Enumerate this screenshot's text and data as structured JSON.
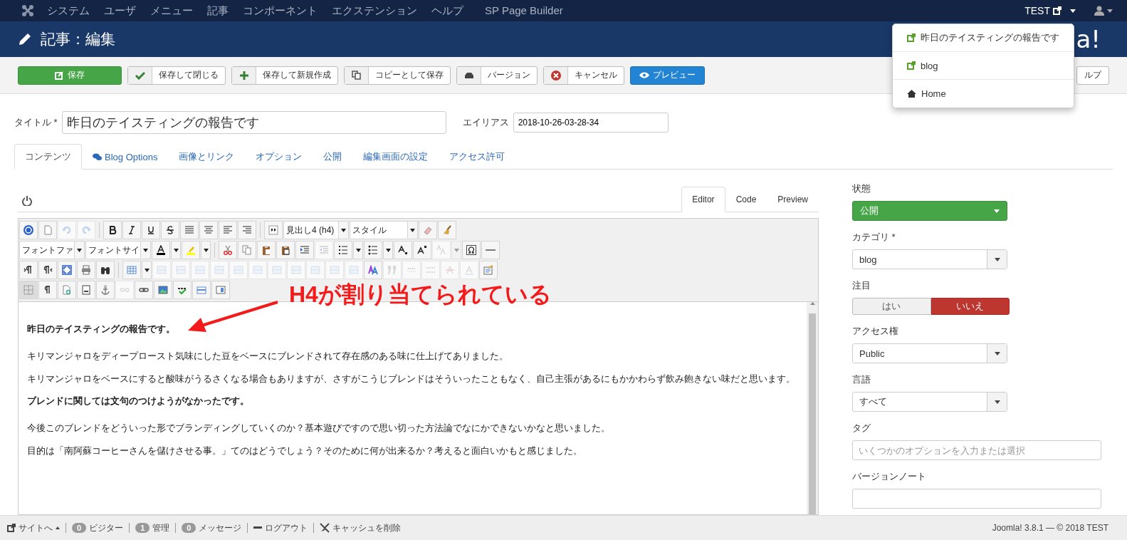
{
  "navbar": {
    "menu": [
      "システム",
      "ユーザ",
      "メニュー",
      "記事",
      "コンポーネント",
      "エクステンション",
      "ヘルプ",
      "SP Page Builder"
    ],
    "site": "TEST"
  },
  "header": {
    "title": "記事：編集",
    "logo_visible": "a!"
  },
  "site_menu": {
    "items": [
      {
        "label": "昨日のテイスティングの報告です",
        "kind": "link"
      },
      {
        "label": "blog",
        "kind": "link"
      },
      {
        "label": "Home",
        "kind": "home"
      }
    ]
  },
  "toolbar": {
    "buttons": [
      {
        "label": "保存",
        "kind": "save"
      },
      {
        "label": "保存して閉じる",
        "kind": "check"
      },
      {
        "label": "保存して新規作成",
        "kind": "plus"
      },
      {
        "label": "コピーとして保存",
        "kind": "copy"
      },
      {
        "label": "バージョン",
        "kind": "archive"
      },
      {
        "label": "キャンセル",
        "kind": "cancel"
      },
      {
        "label": "プレビュー",
        "kind": "preview"
      },
      {
        "label": "ルプ",
        "kind": "help"
      }
    ]
  },
  "title_field": {
    "label": "タイトル *",
    "value": "昨日のテイスティングの報告です"
  },
  "alias_field": {
    "label": "エイリアス",
    "value": "2018-10-26-03-28-34"
  },
  "tabs": [
    {
      "label": "コンテンツ",
      "selected": true,
      "kind": "plain"
    },
    {
      "label": "Blog Options",
      "selected": false,
      "kind": "comment"
    },
    {
      "label": "画像とリンク",
      "selected": false,
      "kind": "plain"
    },
    {
      "label": "オプション",
      "selected": false,
      "kind": "plain"
    },
    {
      "label": "公開",
      "selected": false,
      "kind": "plain"
    },
    {
      "label": "編集画面の設定",
      "selected": false,
      "kind": "plain"
    },
    {
      "label": "アクセス許可",
      "selected": false,
      "kind": "plain"
    }
  ],
  "editor": {
    "modes": [
      {
        "label": "Editor",
        "selected": true
      },
      {
        "label": "Code",
        "selected": false
      },
      {
        "label": "Preview",
        "selected": false
      }
    ],
    "toolbar_rows": [
      [
        {
          "kind": "button",
          "disabled": false
        },
        {
          "kind": "button",
          "disabled": false
        },
        {
          "kind": "button",
          "disabled": true
        },
        {
          "kind": "button",
          "disabled": true
        },
        {
          "kind": "separator"
        },
        {
          "kind": "button",
          "disabled": false
        },
        {
          "kind": "button",
          "disabled": false
        },
        {
          "kind": "button",
          "disabled": false
        },
        {
          "kind": "button",
          "disabled": false
        },
        {
          "kind": "button",
          "disabled": false
        },
        {
          "kind": "button",
          "disabled": false
        },
        {
          "kind": "button",
          "disabled": false
        },
        {
          "kind": "button",
          "disabled": false
        },
        {
          "kind": "separator"
        },
        {
          "kind": "button",
          "disabled": false
        },
        {
          "kind": "select",
          "value": "見出し4 (h4)",
          "wide": false
        },
        {
          "kind": "select",
          "value": "スタイル",
          "wide": true
        },
        {
          "kind": "button",
          "disabled": false
        },
        {
          "kind": "button",
          "disabled": false
        }
      ],
      [
        {
          "kind": "select",
          "value": "フォントファ",
          "wide": false
        },
        {
          "kind": "select",
          "value": "フォントサイ",
          "wide": false
        },
        {
          "kind": "button",
          "disabled": false
        },
        {
          "kind": "dropdown",
          "disabled": false
        },
        {
          "kind": "button",
          "disabled": false
        },
        {
          "kind": "dropdown",
          "disabled": false
        },
        {
          "kind": "separator"
        },
        {
          "kind": "button",
          "disabled": false
        },
        {
          "kind": "button",
          "disabled": false
        },
        {
          "kind": "button",
          "disabled": false
        },
        {
          "kind": "button",
          "disabled": false
        },
        {
          "kind": "button",
          "disabled": false
        },
        {
          "kind": "button",
          "disabled": true
        },
        {
          "kind": "button",
          "disabled": false
        },
        {
          "kind": "dropdown",
          "disabled": false
        },
        {
          "kind": "button",
          "disabled": false
        },
        {
          "kind": "dropdown",
          "disabled": false
        },
        {
          "kind": "button",
          "disabled": false
        },
        {
          "kind": "button",
          "disabled": false
        },
        {
          "kind": "button",
          "disabled": true
        },
        {
          "kind": "dropdown",
          "disabled": true
        },
        {
          "kind": "button",
          "disabled": false
        },
        {
          "kind": "button",
          "disabled": false
        }
      ],
      [
        {
          "kind": "button",
          "disabled": false
        },
        {
          "kind": "button",
          "disabled": false
        },
        {
          "kind": "button",
          "disabled": false
        },
        {
          "kind": "button",
          "disabled": false
        },
        {
          "kind": "button",
          "disabled": false
        },
        {
          "kind": "separator"
        },
        {
          "kind": "button",
          "disabled": false
        },
        {
          "kind": "dropdown",
          "disabled": false
        },
        {
          "kind": "button",
          "disabled": true
        },
        {
          "kind": "button",
          "disabled": true
        },
        {
          "kind": "button",
          "disabled": true
        },
        {
          "kind": "button",
          "disabled": true
        },
        {
          "kind": "button",
          "disabled": true
        },
        {
          "kind": "button",
          "disabled": true
        },
        {
          "kind": "button",
          "disabled": true
        },
        {
          "kind": "button",
          "disabled": true
        },
        {
          "kind": "button",
          "disabled": true
        },
        {
          "kind": "button",
          "disabled": true
        },
        {
          "kind": "button",
          "disabled": true
        },
        {
          "kind": "button",
          "disabled": false
        },
        {
          "kind": "button",
          "disabled": true
        },
        {
          "kind": "button",
          "disabled": true
        },
        {
          "kind": "button",
          "disabled": true
        },
        {
          "kind": "button",
          "disabled": true
        },
        {
          "kind": "button",
          "disabled": true
        },
        {
          "kind": "button",
          "disabled": false
        }
      ],
      [
        {
          "kind": "button",
          "disabled": false
        },
        {
          "kind": "button",
          "disabled": false
        },
        {
          "kind": "button",
          "disabled": false
        },
        {
          "kind": "button",
          "disabled": false
        },
        {
          "kind": "button",
          "disabled": false
        },
        {
          "kind": "button",
          "disabled": true
        },
        {
          "kind": "button",
          "disabled": false
        },
        {
          "kind": "button",
          "disabled": false
        },
        {
          "kind": "button",
          "disabled": false
        },
        {
          "kind": "button",
          "disabled": false
        },
        {
          "kind": "button",
          "disabled": false
        }
      ]
    ],
    "paragraphs": [
      {
        "text": "昨日のテイスティングの報告です。",
        "kind": "heading"
      },
      {
        "text": " キリマンジャロをディープロースト気味にした豆をベースにブレンドされて存在感のある味に仕上げてありました。",
        "kind": "paragraph"
      },
      {
        "text": "キリマンジャロをベースにすると酸味がうるさくなる場合もありますが、さすがこうじブレンドはそういったこともなく、自己主張があるにもかかわらず飲み飽きない味だと思います。",
        "kind": "paragraph"
      },
      {
        "text": "ブレンドに関しては文句のつけようがなかったです。",
        "kind": "heading"
      },
      {
        "text": "今後このブレンドをどういった形でブランディングしていくのか？基本遊びですので思い切った方法論でなにかできないかなと思いました。",
        "kind": "paragraph"
      },
      {
        "text": "目的は「南阿蘇コーヒーさんを儲けさせる事。」てのはどうでしょう？そのために何が出来るか？考えると面白いかもと感じました。",
        "kind": "paragraph"
      }
    ],
    "annotation": "H4が割り当てられている"
  },
  "sidebar": {
    "fields": [
      {
        "label": "状態",
        "kind": "status",
        "value": "公開"
      },
      {
        "label": "カテゴリ *",
        "kind": "select",
        "value": "blog"
      },
      {
        "label": "注目",
        "kind": "toggle",
        "options": [
          {
            "label": "はい",
            "selected": false
          },
          {
            "label": "いいえ",
            "selected": true
          }
        ]
      },
      {
        "label": "アクセス権",
        "kind": "select",
        "value": "Public"
      },
      {
        "label": "言語",
        "kind": "select",
        "value": "すべて"
      },
      {
        "label": "タグ",
        "kind": "text",
        "placeholder": "いくつかのオプションを入力または選択"
      },
      {
        "label": "バージョンノート",
        "kind": "text"
      }
    ]
  },
  "status_bar": {
    "site_link": "サイトへ",
    "items": [
      {
        "count": "0",
        "label": "ビジター",
        "kind": "badge"
      },
      {
        "count": "1",
        "label": "管理",
        "kind": "badge"
      },
      {
        "count": "0",
        "label": "メッセージ",
        "kind": "badge"
      },
      {
        "label": "ログアウト",
        "kind": "logout"
      },
      {
        "label": "キャッシュを削除",
        "kind": "cache"
      }
    ],
    "version": "Joomla! 3.8.1 — © 2018 TEST"
  }
}
